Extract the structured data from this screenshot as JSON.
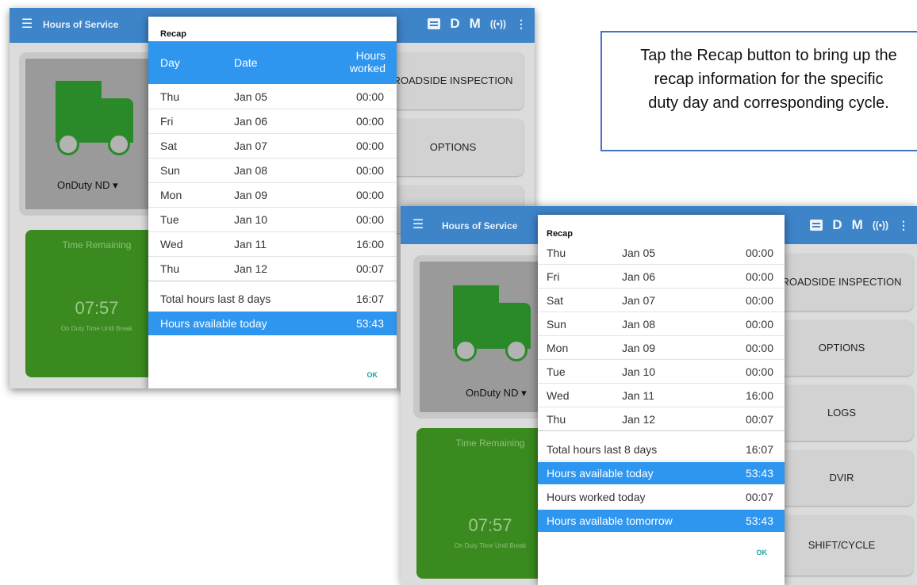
{
  "app": {
    "title": "Hours of Service",
    "status_icons": [
      "message-icon",
      "D",
      "M",
      "eld-signal-icon",
      "overflow-menu-icon"
    ],
    "status_letter_d": "D",
    "status_letter_m": "M"
  },
  "duty_status": "OnDuty ND",
  "time_card": {
    "title": "Time Remaining",
    "clock": "07:57",
    "subtitle": "On Duty Time Until Break"
  },
  "menu_buttons": {
    "roadside": "ROADSIDE INSPECTION",
    "options": "OPTIONS",
    "logs": "LOGS",
    "dvir": "DVIR",
    "shift_cycle": "SHIFT/CYCLE"
  },
  "recap_dialog_1": {
    "title": "Recap",
    "columns": {
      "day": "Day",
      "date": "Date",
      "hours_line1": "Hours",
      "hours_line2": "worked"
    },
    "rows": [
      {
        "day": "Thu",
        "date": "Jan 05",
        "hours": "00:00"
      },
      {
        "day": "Fri",
        "date": "Jan 06",
        "hours": "00:00"
      },
      {
        "day": "Sat",
        "date": "Jan 07",
        "hours": "00:00"
      },
      {
        "day": "Sun",
        "date": "Jan 08",
        "hours": "00:00"
      },
      {
        "day": "Mon",
        "date": "Jan 09",
        "hours": "00:00"
      },
      {
        "day": "Tue",
        "date": "Jan 10",
        "hours": "00:00"
      },
      {
        "day": "Wed",
        "date": "Jan 11",
        "hours": "16:00"
      },
      {
        "day": "Thu",
        "date": "Jan 12",
        "hours": "00:07"
      }
    ],
    "total_label": "Total hours last 8 days",
    "total_value": "16:07",
    "available_today_label": "Hours available today",
    "available_today_value": "53:43",
    "ok_label": "OK"
  },
  "recap_dialog_2": {
    "title": "Recap",
    "rows": [
      {
        "day": "Thu",
        "date": "Jan 05",
        "hours": "00:00"
      },
      {
        "day": "Fri",
        "date": "Jan 06",
        "hours": "00:00"
      },
      {
        "day": "Sat",
        "date": "Jan 07",
        "hours": "00:00"
      },
      {
        "day": "Sun",
        "date": "Jan 08",
        "hours": "00:00"
      },
      {
        "day": "Mon",
        "date": "Jan 09",
        "hours": "00:00"
      },
      {
        "day": "Tue",
        "date": "Jan 10",
        "hours": "00:00"
      },
      {
        "day": "Wed",
        "date": "Jan 11",
        "hours": "16:00"
      },
      {
        "day": "Thu",
        "date": "Jan 12",
        "hours": "00:07"
      }
    ],
    "total_label": "Total hours last 8 days",
    "total_value": "16:07",
    "available_today_label": "Hours available today",
    "available_today_value": "53:43",
    "worked_today_label": "Hours worked today",
    "worked_today_value": "00:07",
    "available_tomorrow_label": "Hours available tomorrow",
    "available_tomorrow_value": "53:43",
    "ok_label": "OK"
  },
  "callout": {
    "text": "Tap the Recap button to bring up the\nrecap information for the specific\nduty day and corresponding cycle."
  },
  "colors": {
    "app_bar": "#3e84c9",
    "dialog_highlight": "#2f96f0",
    "ok_teal": "#1aa39a",
    "truck_green": "#2a8a2a",
    "time_card_green": "#3a8a1f",
    "callout_border": "#4472c4"
  }
}
